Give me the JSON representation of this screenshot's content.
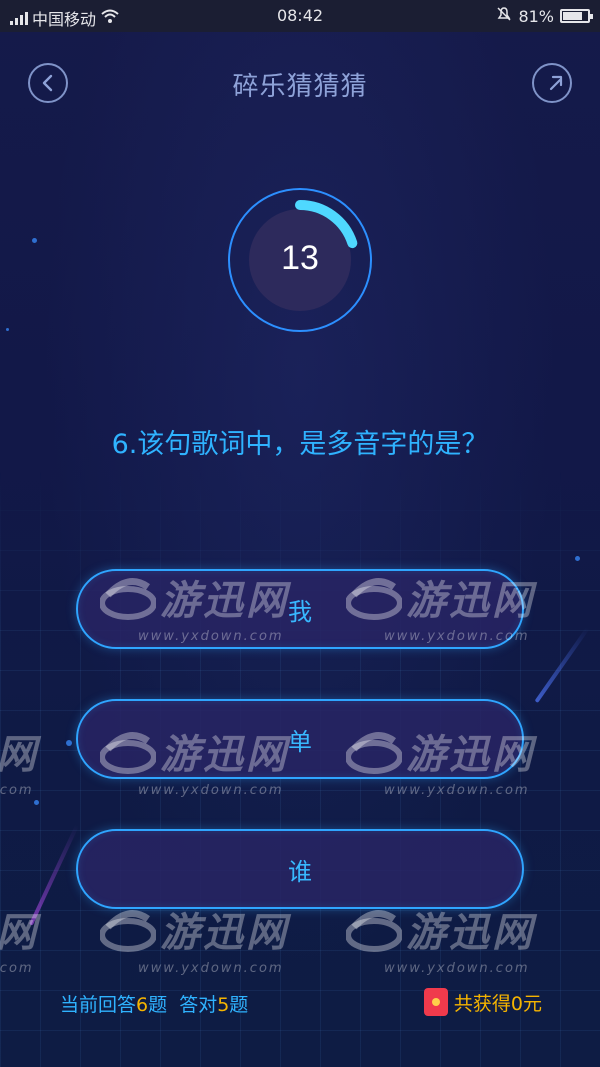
{
  "status_bar": {
    "carrier": "中国移动",
    "time": "08:42",
    "battery": "81%",
    "battery_fraction": 0.81
  },
  "header": {
    "title": "碎乐猜猜猜",
    "back_icon": "back-chevron-icon",
    "share_icon": "share-icon"
  },
  "timer": {
    "value": "13",
    "progress_fraction": 0.2
  },
  "question": {
    "text": "6.该句歌词中，是多音字的是？"
  },
  "options": [
    {
      "label": "我"
    },
    {
      "label": "单"
    },
    {
      "label": "谁"
    }
  ],
  "stats": {
    "prefix": "当前回答",
    "answered": "6",
    "mid": "题  答对",
    "correct": "5",
    "suffix": "题"
  },
  "reward": {
    "text": "共获得0元",
    "icon": "red-packet-icon"
  },
  "watermark": {
    "brand": "游迅网",
    "url": "www.yxdown.com"
  },
  "colors": {
    "accent": "#2fb3ff",
    "highlight": "#f5b400",
    "title": "#8ea2d8",
    "background": "#121848"
  }
}
